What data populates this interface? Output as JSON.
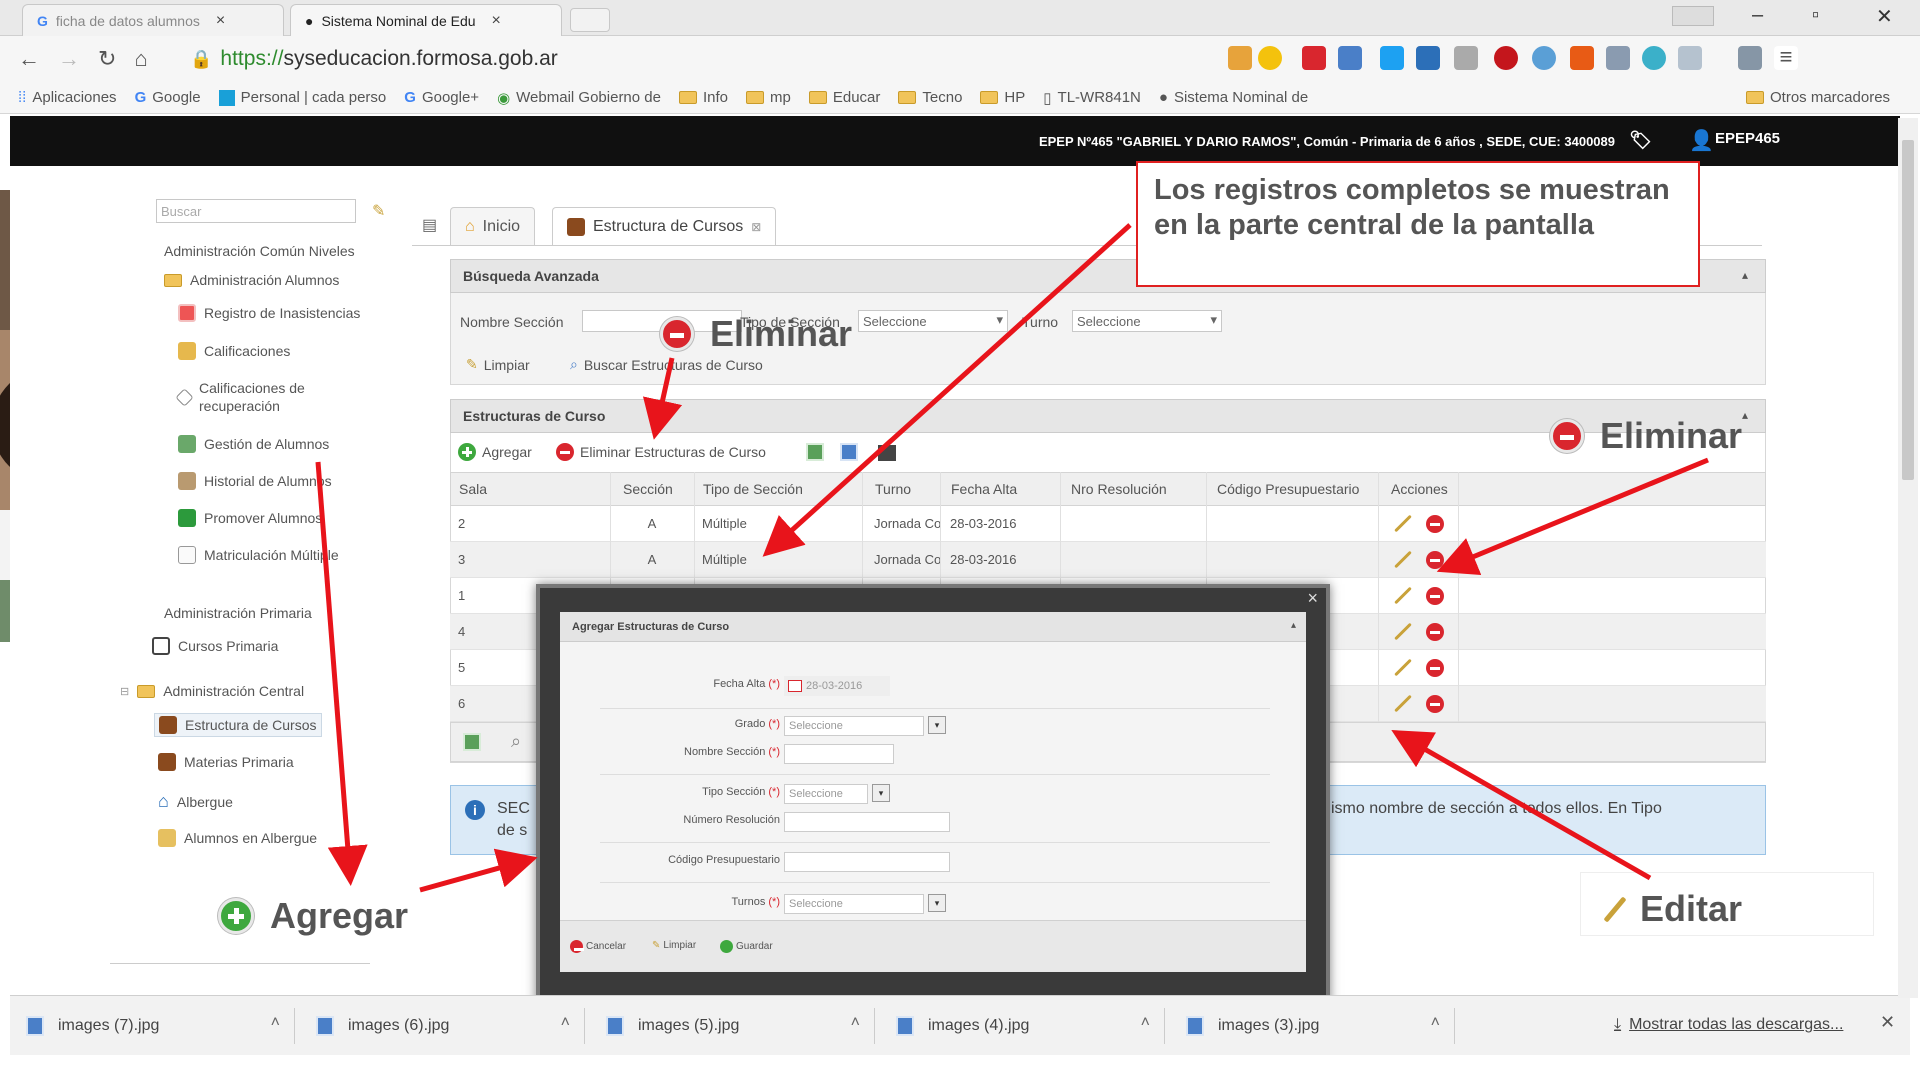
{
  "browser": {
    "tabs": [
      {
        "label": "ficha de datos alumnos",
        "active": false
      },
      {
        "label": "Sistema Nominal de Edu",
        "active": true
      }
    ],
    "url_scheme": "https://",
    "url_host": "syseducacion.formosa.gob.ar",
    "bookmarks": [
      "Aplicaciones",
      "Google",
      "Personal | cada perso",
      "Google+",
      "Webmail Gobierno de",
      "Info",
      "mp",
      "Educar",
      "Tecno",
      "HP",
      "TL-WR841N",
      "Sistema Nominal de"
    ],
    "other_bookmarks": "Otros marcadores"
  },
  "header": {
    "school": "EPEP Nº465 \"GABRIEL Y DARIO RAMOS\", Común - Primaria de 6 años , SEDE, CUE: 3400089",
    "user": "EPEP465"
  },
  "sidebar": {
    "search_placeholder": "Buscar",
    "items": [
      {
        "label": "Administración Común Niveles",
        "icon": "none"
      },
      {
        "label": "Administración Alumnos",
        "icon": "folder-icon"
      },
      {
        "label": "Registro de Inasistencias",
        "icon": "calendar-icon"
      },
      {
        "label": "Calificaciones",
        "icon": "grades-icon"
      },
      {
        "label": "Calificaciones de recuperación",
        "icon": "diamond-icon"
      },
      {
        "label": "Gestión de Alumnos",
        "icon": "students-icon"
      },
      {
        "label": "Historial de Alumnos",
        "icon": "history-icon"
      },
      {
        "label": "Promover Alumnos",
        "icon": "promote-icon"
      },
      {
        "label": "Matriculación Múltiple",
        "icon": "enroll-icon"
      },
      {
        "label": "Administración Primaria",
        "icon": "none"
      },
      {
        "label": "Cursos Primaria",
        "icon": "school-icon"
      },
      {
        "label": "Administración Central",
        "icon": "folder-icon"
      },
      {
        "label": "Estructura de Cursos",
        "icon": "book-icon"
      },
      {
        "label": "Materias Primaria",
        "icon": "book-icon"
      },
      {
        "label": "Albergue",
        "icon": "home-icon"
      },
      {
        "label": "Alumnos en Albergue",
        "icon": "pencil-icon"
      }
    ]
  },
  "tabs": {
    "home": "Inicio",
    "current": "Estructura de Cursos"
  },
  "search_panel": {
    "title": "Búsqueda Avanzada",
    "name_label": "Nombre Sección",
    "type_label": "Tipo de Sección",
    "type_value": "Seleccione",
    "shift_label": "Turno",
    "shift_value": "Seleccione",
    "clear": "Limpiar",
    "search": "Buscar Estructuras de Curso"
  },
  "grid_panel": {
    "title": "Estructuras de Curso",
    "add": "Agregar",
    "delete": "Eliminar Estructuras de Curso",
    "columns": [
      "Sala",
      "Sección",
      "Tipo de Sección",
      "Turno",
      "Fecha Alta",
      "Nro Resolución",
      "Código Presupuestario",
      "Acciones"
    ],
    "rows": [
      [
        "2",
        "A",
        "Múltiple",
        "Jornada Co",
        "28-03-2016",
        "",
        ""
      ],
      [
        "3",
        "A",
        "Múltiple",
        "Jornada Co",
        "28-03-2016",
        "",
        ""
      ],
      [
        "1",
        "",
        "",
        "",
        "",
        "",
        ""
      ],
      [
        "4",
        "",
        "",
        "",
        "",
        "",
        ""
      ],
      [
        "5",
        "",
        "",
        "",
        "",
        "",
        ""
      ],
      [
        "6",
        "",
        "",
        "",
        "",
        "",
        ""
      ]
    ]
  },
  "info": {
    "prefix": "SEC",
    "prefix2": "de s",
    "text": "ismo nombre de sección a todos ellos. En Tipo"
  },
  "modal": {
    "title": "Agregar Estructuras de Curso",
    "close": "×",
    "fields": [
      {
        "label": "Fecha Alta",
        "required": true,
        "value": "28-03-2016"
      },
      {
        "label": "Grado",
        "required": true,
        "value": "Seleccione"
      },
      {
        "label": "Nombre Sección",
        "required": true,
        "value": ""
      },
      {
        "label": "Tipo Sección",
        "required": true,
        "value": "Seleccione"
      },
      {
        "label": "Número Resolución",
        "required": false,
        "value": ""
      },
      {
        "label": "Código Presupuestario",
        "required": false,
        "value": ""
      },
      {
        "label": "Turnos",
        "required": true,
        "value": "Seleccione"
      }
    ],
    "cancel": "Cancelar",
    "clear": "Limpiar",
    "save": "Guardar"
  },
  "annotations": {
    "callout": "Los registros completos se muestran en la parte central de la pantalla",
    "eliminar": "Eliminar",
    "agregar": "Agregar",
    "editar": "Editar"
  },
  "downloads": {
    "files": [
      "images (7).jpg",
      "images (6).jpg",
      "images (5).jpg",
      "images (4).jpg",
      "images (3).jpg"
    ],
    "show_all": "Mostrar todas las descargas..."
  },
  "colors": {
    "header_bg": "#101010",
    "annotation_arrow": "#e8141b",
    "delete": "#d9262e",
    "add": "#3ea83e",
    "info_bg": "#dbeaf7"
  }
}
